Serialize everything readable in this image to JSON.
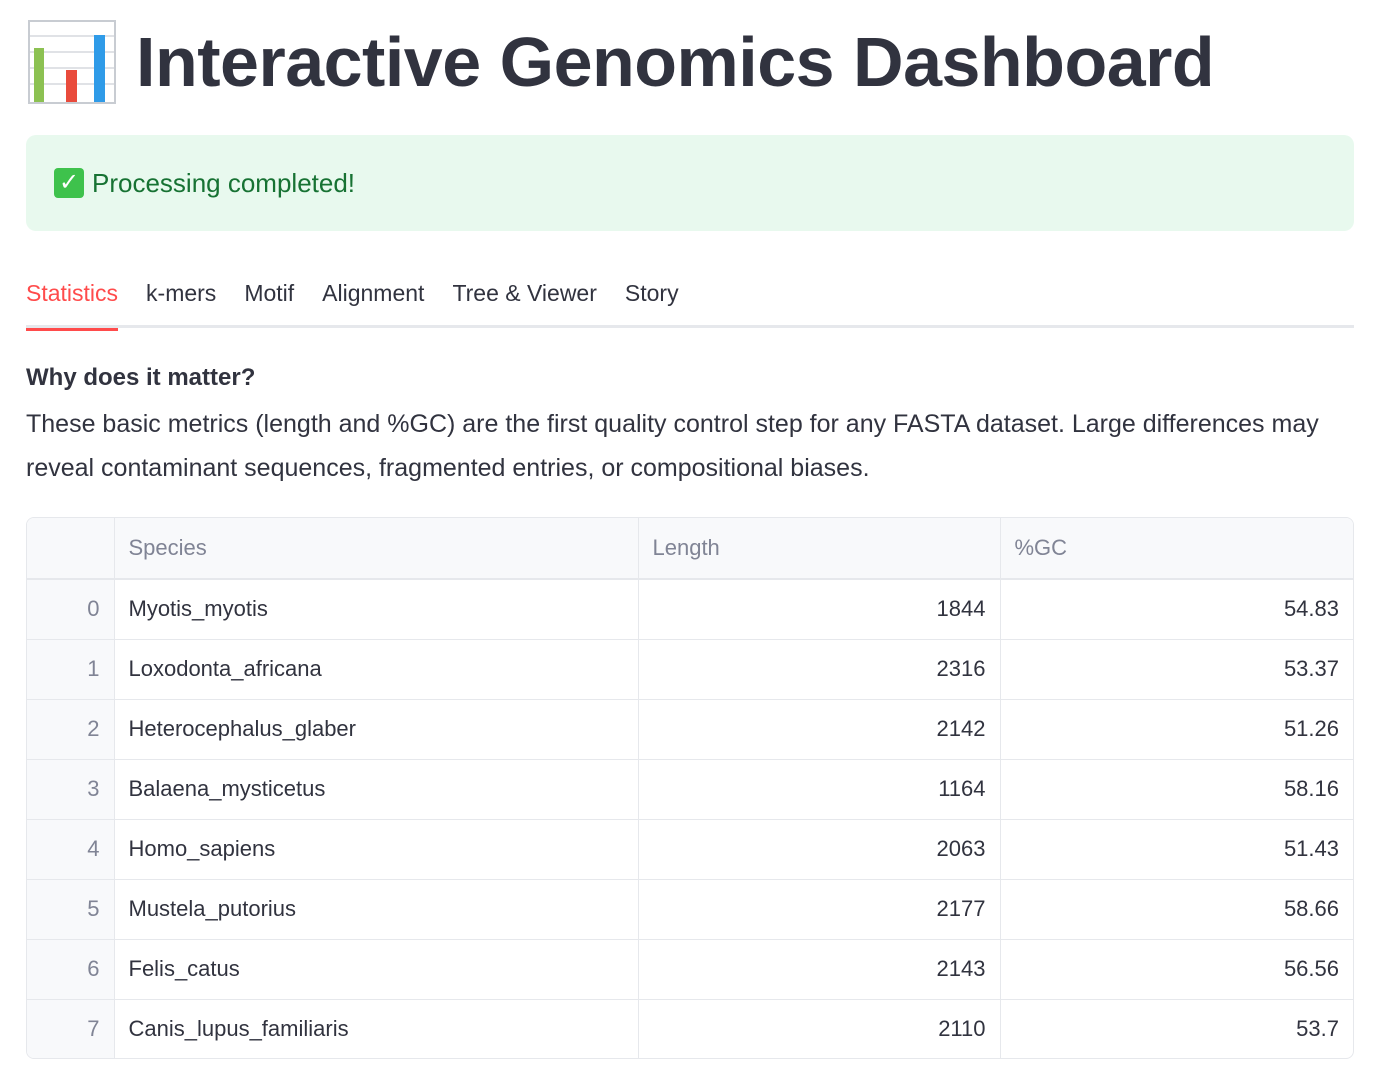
{
  "header": {
    "icon": "bar-chart-icon",
    "title": "Interactive Genomics Dashboard"
  },
  "alert": {
    "icon": "check-icon",
    "text": "Processing completed!",
    "color": "#177233",
    "background": "#e8f9ee"
  },
  "tabs": [
    {
      "label": "Statistics",
      "active": true
    },
    {
      "label": "k-mers",
      "active": false
    },
    {
      "label": "Motif",
      "active": false
    },
    {
      "label": "Alignment",
      "active": false
    },
    {
      "label": "Tree & Viewer",
      "active": false
    },
    {
      "label": "Story",
      "active": false
    }
  ],
  "accent_color": "#ff4b4b",
  "section": {
    "heading": "Why does it matter?",
    "text": "These basic metrics (length and %GC) are the first quality control step for any FASTA dataset. Large differences may reveal contaminant sequences, fragmented entries, or compositional biases."
  },
  "table": {
    "columns": [
      "",
      "Species",
      "Length",
      "%GC"
    ],
    "rows": [
      [
        "0",
        "Myotis_myotis",
        "1844",
        "54.83"
      ],
      [
        "1",
        "Loxodonta_africana",
        "2316",
        "53.37"
      ],
      [
        "2",
        "Heterocephalus_glaber",
        "2142",
        "51.26"
      ],
      [
        "3",
        "Balaena_mysticetus",
        "1164",
        "58.16"
      ],
      [
        "4",
        "Homo_sapiens",
        "2063",
        "51.43"
      ],
      [
        "5",
        "Mustela_putorius",
        "2177",
        "58.66"
      ],
      [
        "6",
        "Felis_catus",
        "2143",
        "56.56"
      ],
      [
        "7",
        "Canis_lupus_familiaris",
        "2110",
        "53.7"
      ]
    ]
  }
}
